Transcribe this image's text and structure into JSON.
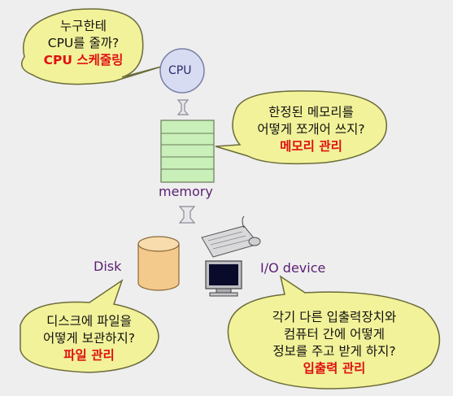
{
  "bubbles": {
    "cpu": {
      "line1": "누구한테",
      "line2": "CPU를 줄까?",
      "highlight": "CPU 스케줄링"
    },
    "memory": {
      "line1": "한정된 메모리를",
      "line2": "어떻게 쪼개어 쓰지?",
      "highlight": "메모리 관리"
    },
    "disk": {
      "line1": "디스크에 파일을",
      "line2": "어떻게 보관하지?",
      "highlight": "파일 관리"
    },
    "io": {
      "line1": "각기 다른 입출력장치와",
      "line2": "컴퓨터 간에 어떻게",
      "line3": "정보를 주고 받게 하지?",
      "highlight": "입출력  관리"
    }
  },
  "labels": {
    "cpu": "CPU",
    "memory": "memory",
    "disk": "Disk",
    "io": "I/O device"
  },
  "colors": {
    "bubble_fill": "#f2f29a",
    "bubble_stroke": "#6b6b3a",
    "memory_fill": "#c8f0b8",
    "memory_stroke": "#6a7b5a",
    "cpu_fill": "#d8dcf2",
    "disk_fill": "#f4c98c",
    "label_color": "#5a1f73",
    "highlight_color": "#e01010"
  }
}
